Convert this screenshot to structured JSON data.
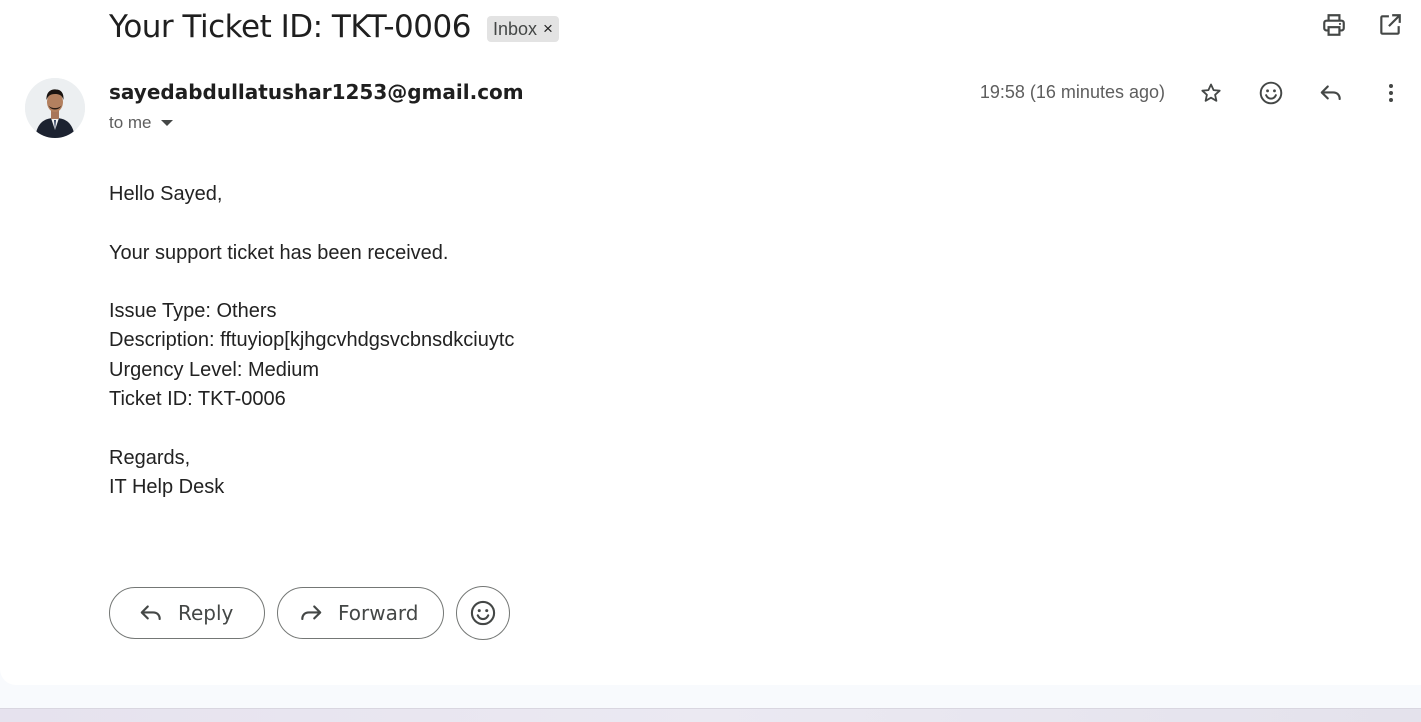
{
  "email": {
    "subject": "Your Ticket ID: TKT-0006",
    "label_chip": "Inbox",
    "label_chip_remove": "×",
    "sender": "sayedabdullatushar1253@gmail.com",
    "recipient_summary": "to me",
    "timestamp": "19:58 (16 minutes ago)",
    "body": {
      "greeting": "Hello Sayed,",
      "intro": "Your support ticket has been received.",
      "issue_type": "Issue Type: Others",
      "description": "Description: fftuyiop[kjhgcvhdgsvcbnsdkciuytc",
      "urgency": "Urgency Level: Medium",
      "ticket_id": "Ticket ID: TKT-0006",
      "closing": "Regards,",
      "signature": "IT Help Desk"
    }
  },
  "top_actions": [
    {
      "icon": "print-icon"
    },
    {
      "icon": "open-in-new-window-icon"
    }
  ],
  "message_actions": [
    {
      "icon": "star-icon"
    },
    {
      "icon": "emoji-reaction-icon"
    },
    {
      "icon": "reply-icon"
    },
    {
      "icon": "more-vert-icon"
    }
  ],
  "footer_actions": {
    "reply_label": "Reply",
    "forward_label": "Forward"
  },
  "colors": {
    "text_primary": "#1f1f1f",
    "text_secondary": "#5e5e5e",
    "chip_background": "#e3e3e3",
    "page_background": "#f8fafd",
    "card_background": "#ffffff"
  }
}
